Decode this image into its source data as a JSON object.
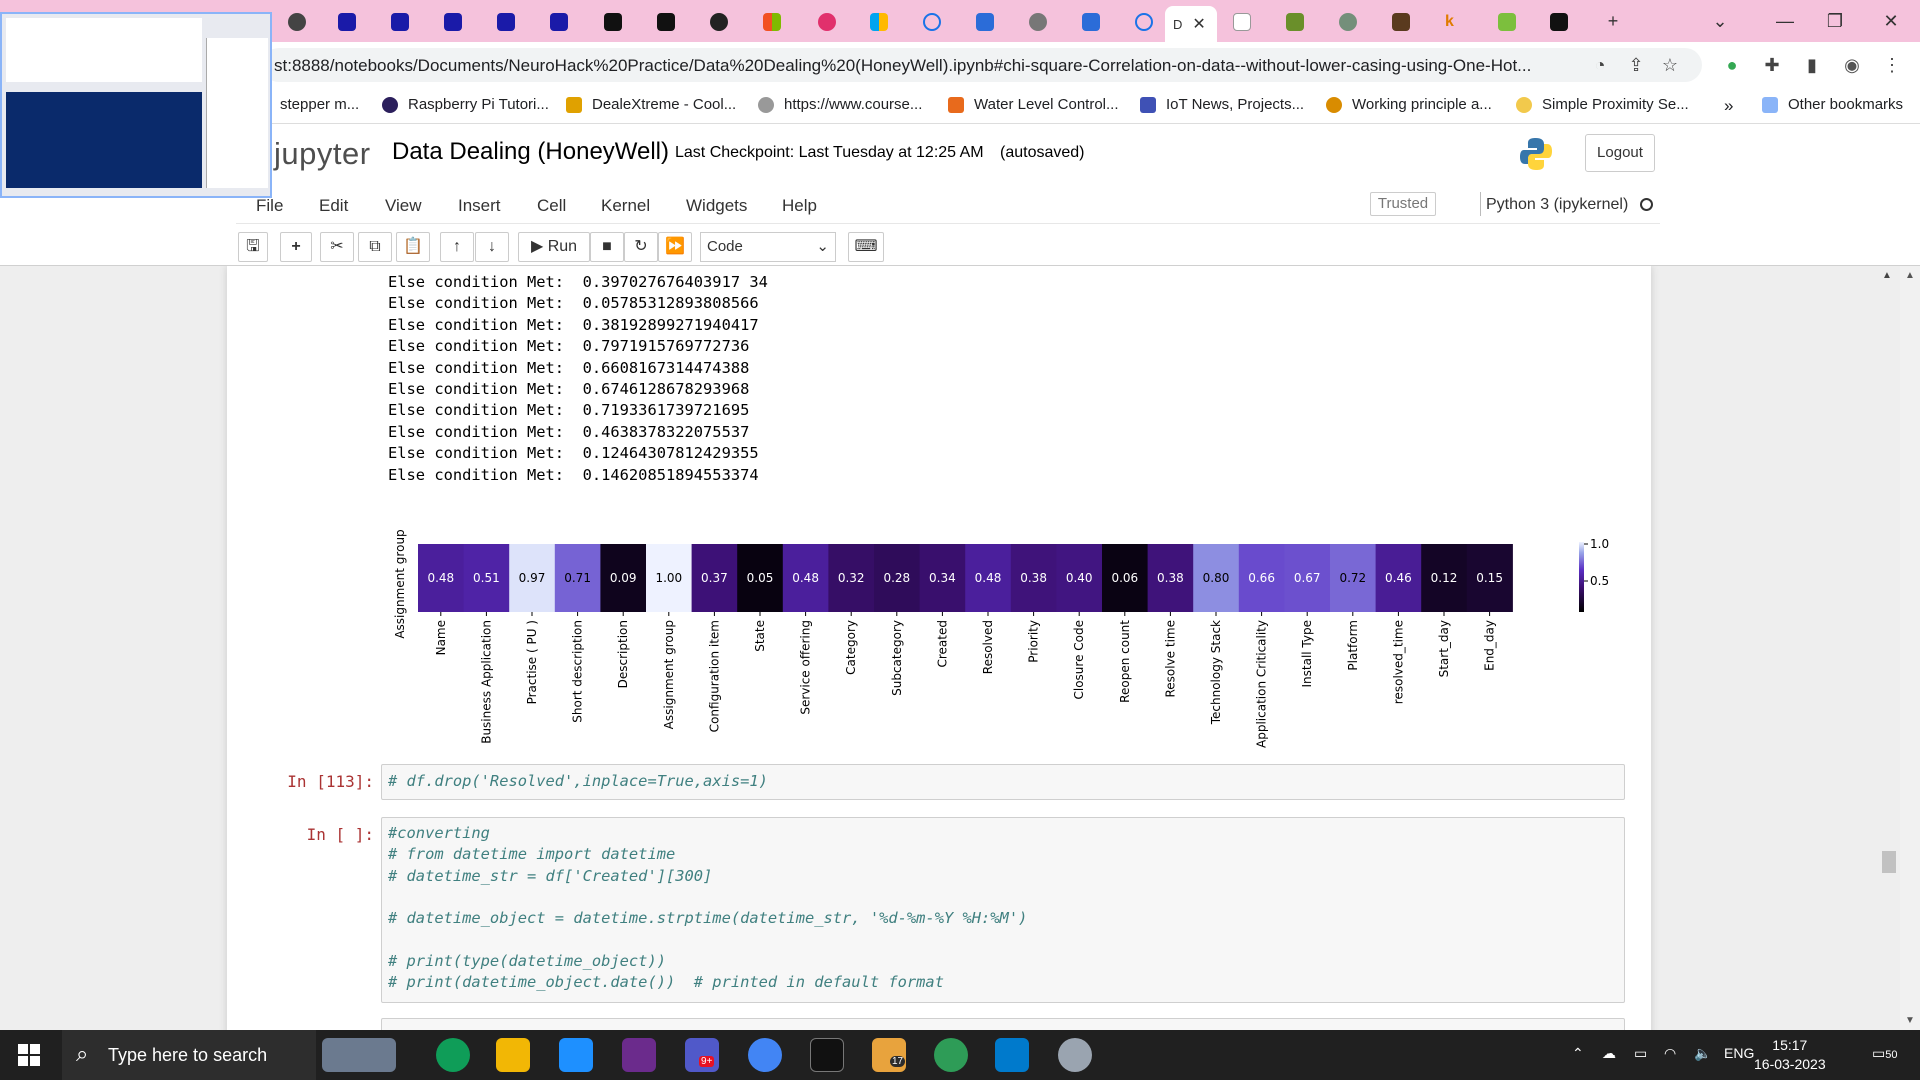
{
  "browser": {
    "active_tab_title": "D",
    "url": "st:8888/notebooks/Documents/NeuroHack%20Practice/Data%20Dealing%20(HoneyWell).ipynb#chi-square-Correlation-on-data--without-lower-casing-using-One-Hot...",
    "bookmarks": [
      "stepper m...",
      "Raspberry Pi Tutori...",
      "DealeXtreme - Cool...",
      "https://www.course...",
      "Water Level Control...",
      "IoT News, Projects...",
      "Working principle a...",
      "Simple Proximity Se..."
    ],
    "bookmarks_overflow": "»",
    "other_bookmarks": "Other bookmarks",
    "new_tab": "+"
  },
  "jupyter": {
    "logo": "jupyter",
    "notebook_name": "Data Dealing (HoneyWell)",
    "checkpoint": "Last Checkpoint: Last Tuesday at 12:25 AM",
    "autosaved": "(autosaved)",
    "logout": "Logout",
    "menus": [
      "File",
      "Edit",
      "View",
      "Insert",
      "Cell",
      "Kernel",
      "Widgets",
      "Help"
    ],
    "trusted": "Trusted",
    "kernel": "Python 3 (ipykernel)",
    "run_label": "Run",
    "cell_type": "Code"
  },
  "output_lines": [
    "Else condition Met:  0.397027676403917 34",
    "Else condition Met:  0.05785312893808566",
    "Else condition Met:  0.38192899271940417",
    "Else condition Met:  0.7971915769772736",
    "Else condition Met:  0.6608167314474388",
    "Else condition Met:  0.6746128678293968",
    "Else condition Met:  0.7193361739721695",
    "Else condition Met:  0.4638378322075537",
    "Else condition Met:  0.12464307812429355",
    "Else condition Met:  0.14620851894553374"
  ],
  "cells": [
    {
      "prompt": "In [113]:",
      "code": "# df.drop('Resolved',inplace=True,axis=1)"
    },
    {
      "prompt": "In [ ]:",
      "code": "#converting\n# from datetime import datetime\n# datetime_str = df['Created'][300]\n\n# datetime_object = datetime.strptime(datetime_str, '%d-%m-%Y %H:%M')\n\n# print(type(datetime_object))\n# print(datetime_object.date())  # printed in default format"
    }
  ],
  "chart_data": {
    "type": "heatmap",
    "ylabel": "Assignment group",
    "categories": [
      "Name",
      "Business Application",
      "Practise ( PU )",
      "Short description",
      "Description",
      "Assignment group",
      "Configuration item",
      "State",
      "Service offering",
      "Category",
      "Subcategory",
      "Created",
      "Resolved",
      "Priority",
      "Closure Code",
      "Reopen count",
      "Resolve time",
      "Technology Stack",
      "Application Criticality",
      "Install Type",
      "Platform",
      "resolved_time",
      "Start_day",
      "End_day"
    ],
    "values": [
      0.48,
      0.51,
      0.97,
      0.71,
      0.09,
      1.0,
      0.37,
      0.05,
      0.48,
      0.32,
      0.28,
      0.34,
      0.48,
      0.38,
      0.4,
      0.06,
      0.38,
      0.8,
      0.66,
      0.67,
      0.72,
      0.46,
      0.12,
      0.15
    ],
    "value_labels": [
      "0.48",
      "0.51",
      "0.97",
      "0.71",
      "0.09",
      "1.00",
      "0.37",
      "0.05",
      "0.48",
      "0.32",
      "0.28",
      "0.34",
      "0.48",
      "0.38",
      "0.40",
      "0.06",
      "0.38",
      "0.80",
      "0.66",
      "0.67",
      "0.72",
      "0.46",
      "0.12",
      "0.15"
    ],
    "colorbar_ticks": [
      "1.0",
      "0.5"
    ],
    "colormap": "purple"
  },
  "taskbar": {
    "search_placeholder": "Type here to search",
    "teams_badge": "9+",
    "mail_badge": "17",
    "language": "ENG",
    "time": "15:17",
    "date": "16-03-2023",
    "notifications": "50"
  }
}
